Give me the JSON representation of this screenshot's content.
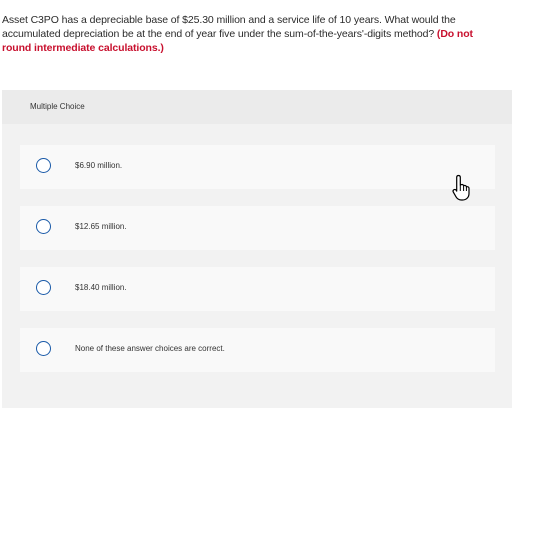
{
  "question": {
    "text": "Asset C3PO has a depreciable base of $25.30 million and a service life of 10 years. What would the accumulated depreciation be at the end of year five under the sum-of-the-years'-digits method? ",
    "emphasis": "(Do not round intermediate calculations.)"
  },
  "multiple_choice": {
    "label": "Multiple Choice",
    "options": [
      {
        "label": "$6.90 million."
      },
      {
        "label": "$12.65 million."
      },
      {
        "label": "$18.40 million."
      },
      {
        "label": "None of these answer choices are correct."
      }
    ]
  },
  "colors": {
    "radio_border": "#1a5aa8",
    "emphasis_text": "#c8102e",
    "panel_bg": "#f2f2f2",
    "option_bg": "#f9f9f9"
  },
  "icons": {
    "cursor": "hand-pointer-icon",
    "radio": "radio-unselected-icon"
  }
}
